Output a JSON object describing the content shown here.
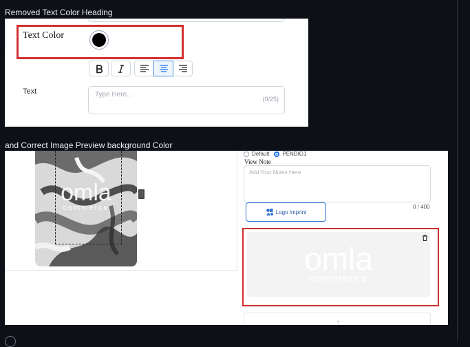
{
  "captions": {
    "top": "Removed Text Color Heading",
    "middle": "and Correct Image Preview background Color"
  },
  "panel1": {
    "text_color_label": "Text Color",
    "swatch_color": "#000000",
    "format_buttons": [
      "bold-icon",
      "italic-icon",
      "align-left-icon",
      "align-center-icon",
      "align-right-icon"
    ],
    "active_format": "align-center-icon",
    "text_label": "Text",
    "text_placeholder": "Type Here...",
    "text_counter": "(0/25)"
  },
  "panel2": {
    "radio_default": "Default",
    "radio_selected": "PENDIG1",
    "view_note_label": "View Note",
    "notes_placeholder": "Add Your Notes Here",
    "notes_counter": "0 / 400",
    "logo_imprint_label": "Logo Imprint",
    "watermark_text": "omla",
    "watermark_sub": "commerce",
    "preview_bg": "#f3f3f3"
  },
  "colors": {
    "highlight_red": "#d32f2f",
    "accent_blue": "#1a73e8"
  }
}
